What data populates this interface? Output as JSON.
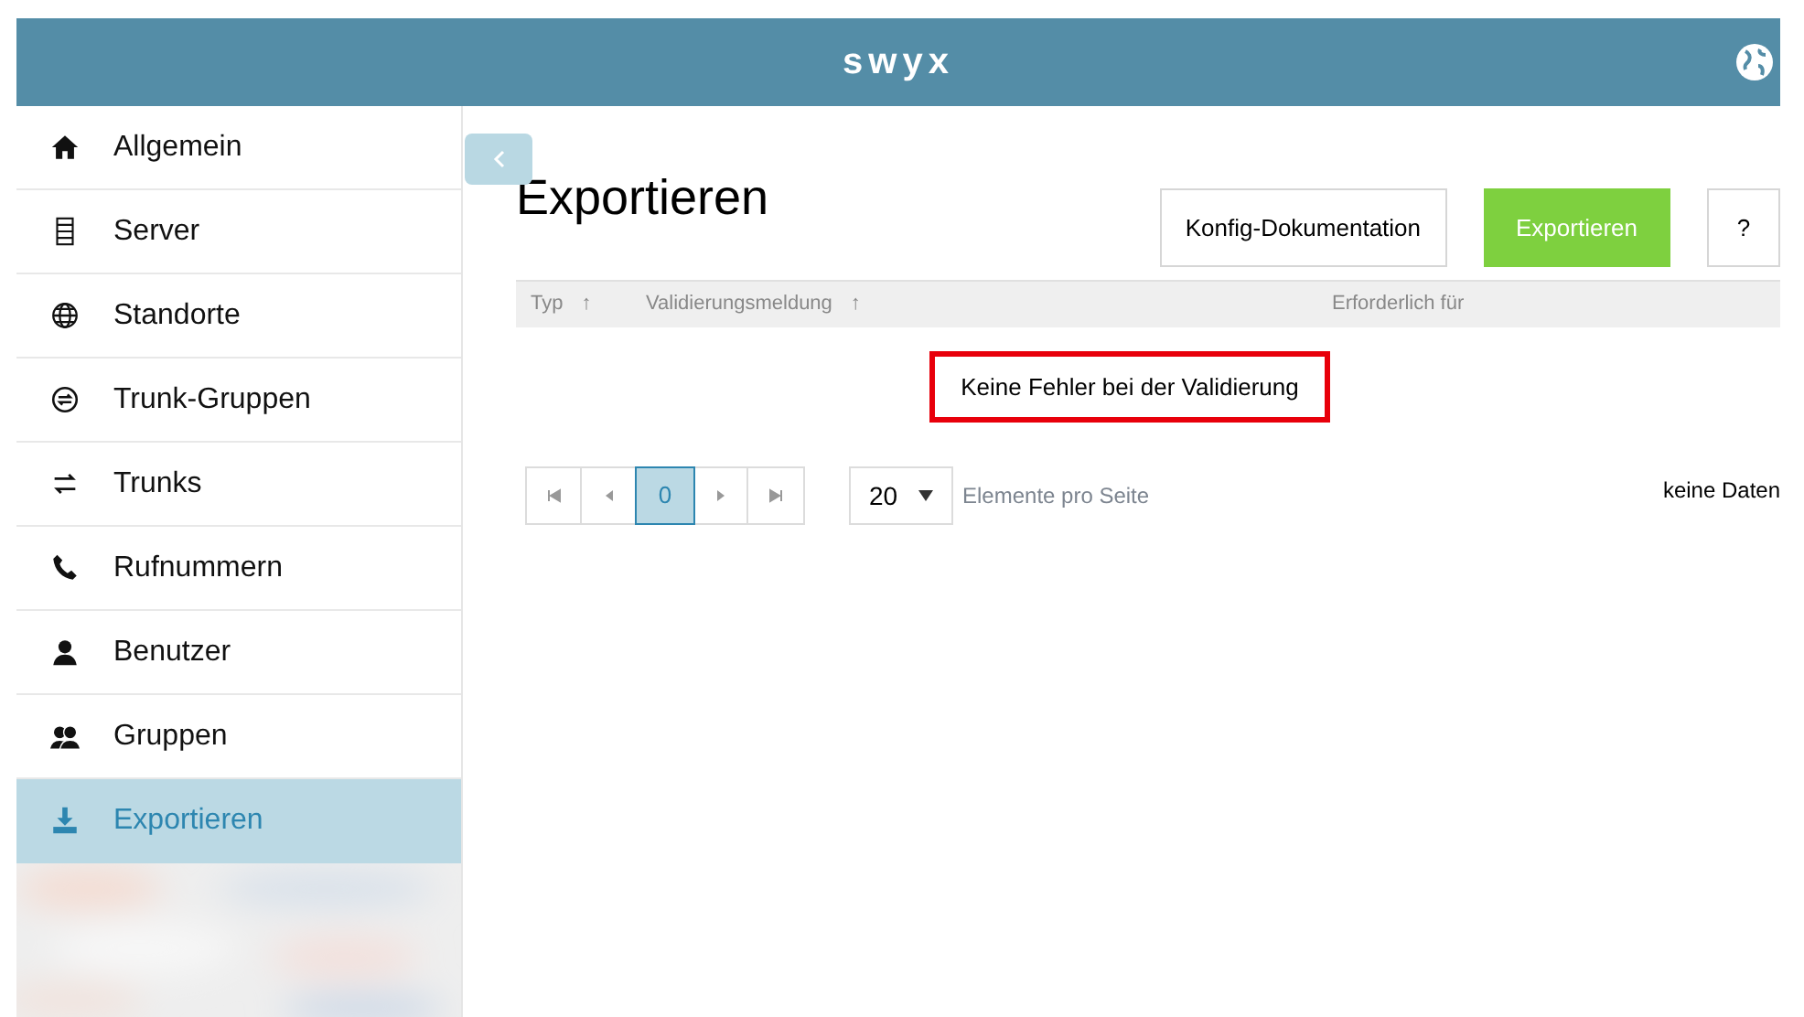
{
  "header": {
    "logo": "swyx"
  },
  "sidebar": {
    "items": [
      {
        "label": "Allgemein",
        "selected": false
      },
      {
        "label": "Server",
        "selected": false
      },
      {
        "label": "Standorte",
        "selected": false
      },
      {
        "label": "Trunk-Gruppen",
        "selected": false
      },
      {
        "label": "Trunks",
        "selected": false
      },
      {
        "label": "Rufnummern",
        "selected": false
      },
      {
        "label": "Benutzer",
        "selected": false
      },
      {
        "label": "Gruppen",
        "selected": false
      },
      {
        "label": "Exportieren",
        "selected": true
      }
    ]
  },
  "page": {
    "title": "Exportieren",
    "buttons": [
      {
        "label": "Konfig-Dokumentation",
        "kind": "outline"
      },
      {
        "label": "Exportieren",
        "kind": "primary"
      },
      {
        "label": "?",
        "kind": "outline"
      }
    ],
    "table": {
      "columns": [
        {
          "label": "Typ",
          "sort": "↑"
        },
        {
          "label": "Validierungsmeldung",
          "sort": "↑"
        },
        {
          "label": "Erforderlich für"
        }
      ],
      "message": "Keine Fehler bei der Validierung"
    },
    "pagination": {
      "pages": [
        {
          "label": "0",
          "selected": true
        }
      ],
      "page_size": "20",
      "page_size_label": "Elemente pro Seite",
      "summary": "keine Daten"
    }
  }
}
